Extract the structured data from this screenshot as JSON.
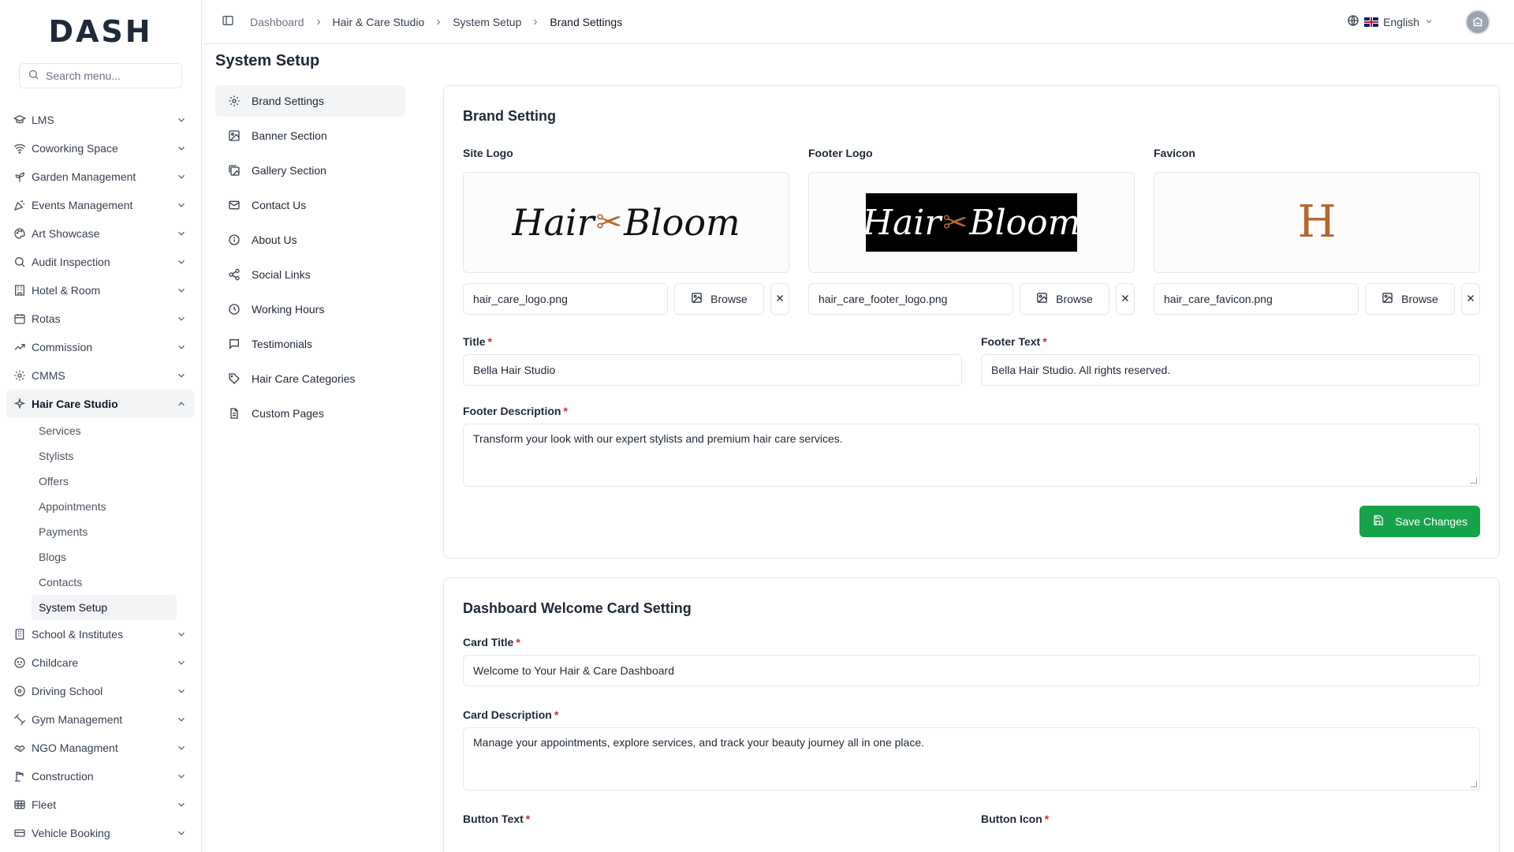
{
  "brand": "DASH",
  "search": {
    "placeholder": "Search menu..."
  },
  "sidebar": {
    "items": [
      {
        "label": "LMS",
        "icon": "graduation-cap-icon"
      },
      {
        "label": "Coworking Space",
        "icon": "wifi-icon"
      },
      {
        "label": "Garden Management",
        "icon": "plant-icon"
      },
      {
        "label": "Events Management",
        "icon": "party-icon"
      },
      {
        "label": "Art Showcase",
        "icon": "palette-icon"
      },
      {
        "label": "Audit Inspection",
        "icon": "search-icon"
      },
      {
        "label": "Hotel & Room",
        "icon": "hotel-icon"
      },
      {
        "label": "Rotas",
        "icon": "calendar-icon"
      },
      {
        "label": "Commission",
        "icon": "trend-icon"
      },
      {
        "label": "CMMS",
        "icon": "gear-icon"
      },
      {
        "label": "Hair Care Studio",
        "icon": "sparkle-icon"
      }
    ],
    "sub_items": [
      {
        "label": "Services"
      },
      {
        "label": "Stylists"
      },
      {
        "label": "Offers"
      },
      {
        "label": "Appointments"
      },
      {
        "label": "Payments"
      },
      {
        "label": "Blogs"
      },
      {
        "label": "Contacts"
      },
      {
        "label": "System Setup"
      }
    ],
    "items_after": [
      {
        "label": "School & Institutes",
        "icon": "building-icon"
      },
      {
        "label": "Childcare",
        "icon": "baby-icon"
      },
      {
        "label": "Driving School",
        "icon": "steering-icon"
      },
      {
        "label": "Gym Management",
        "icon": "dumbbell-icon"
      },
      {
        "label": "NGO Managment",
        "icon": "handshake-icon"
      },
      {
        "label": "Construction",
        "icon": "crane-icon"
      },
      {
        "label": "Fleet",
        "icon": "globe-icon"
      },
      {
        "label": "Vehicle Booking",
        "icon": "car-icon"
      }
    ]
  },
  "breadcrumb": [
    "Dashboard",
    "Hair & Care Studio",
    "System Setup",
    "Brand Settings"
  ],
  "language": "English",
  "page_title": "System Setup",
  "settings_menu": [
    "Brand Settings",
    "Banner Section",
    "Gallery Section",
    "Contact Us",
    "About Us",
    "Social Links",
    "Working Hours",
    "Testimonials",
    "Hair Care Categories",
    "Custom Pages"
  ],
  "brand_card": {
    "title": "Brand Setting",
    "site_logo_label": "Site Logo",
    "footer_logo_label": "Footer Logo",
    "favicon_label": "Favicon",
    "logo_text_left": "Hair",
    "logo_text_right": "Bloom",
    "favicon_text": "H",
    "site_logo_file": "hair_care_logo.png",
    "footer_logo_file": "hair_care_footer_logo.png",
    "favicon_file": "hair_care_favicon.png",
    "browse_label": "Browse",
    "title_label": "Title",
    "title_value": "Bella Hair Studio",
    "footer_text_label": "Footer Text",
    "footer_text_value": "Bella Hair Studio. All rights reserved.",
    "footer_desc_label": "Footer Description",
    "footer_desc_value": "Transform your look with our expert stylists and premium hair care services.",
    "save_label": "Save Changes"
  },
  "welcome_card": {
    "title": "Dashboard Welcome Card Setting",
    "card_title_label": "Card Title",
    "card_title_value": "Welcome to Your Hair & Care Dashboard",
    "card_desc_label": "Card Description",
    "card_desc_value": "Manage your appointments, explore services, and track your beauty journey all in one place.",
    "button_text_label": "Button Text",
    "button_icon_label": "Button Icon"
  },
  "colors": {
    "accent": "#16a34a",
    "logo_brown": "#b5652e",
    "required": "#dc2626"
  }
}
